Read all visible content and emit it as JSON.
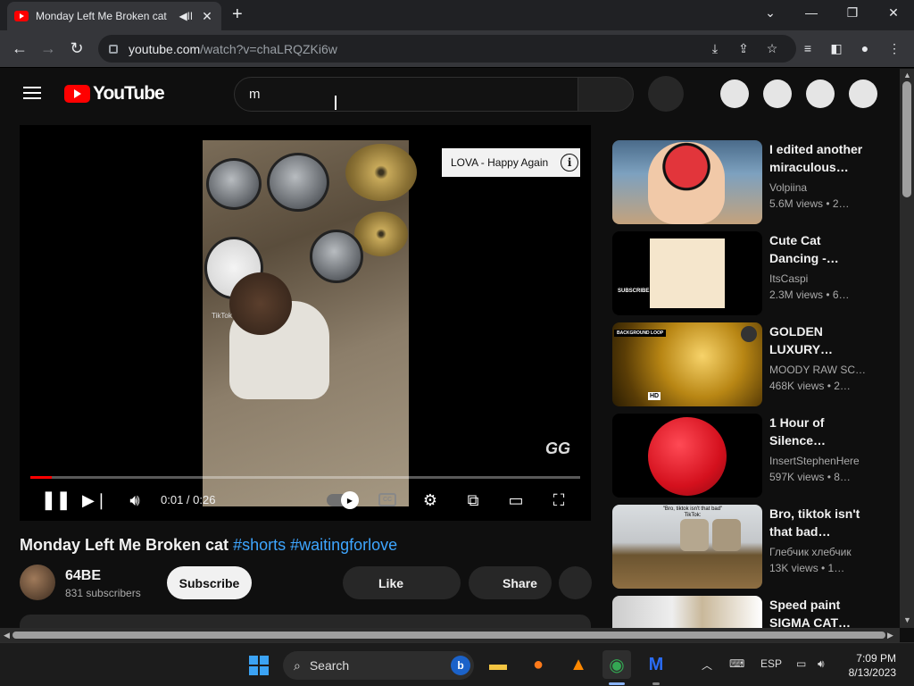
{
  "browser": {
    "tab_title": "Monday Left Me Broken cat",
    "url_host": "youtube.com",
    "url_path": "/watch?v=chaLRQZKi6w"
  },
  "youtube": {
    "logo_text": "YouTube",
    "search_value": "m"
  },
  "player": {
    "song_chip": "LOVA - Happy Again",
    "tiktok_label": "TikTok",
    "brand_mark": "GG",
    "time": "0:01 / 0:26",
    "progress_fraction": 0.0385
  },
  "video": {
    "title": "Monday Left Me Broken cat",
    "hashtags": "#shorts #waitingforlove",
    "channel": "64BE",
    "subscribers": "831 subscribers",
    "subscribe_label": "Subscribe",
    "like_label": "Like",
    "share_label": "Share"
  },
  "recommendations": [
    {
      "title": "I edited another\nmiraculous…",
      "channel": "Volpiina",
      "meta": "5.6M views  • 2…"
    },
    {
      "title": "Cute Cat\nDancing -…",
      "channel": "ItsCaspi",
      "meta": "2.3M views  • 6…"
    },
    {
      "title": "GOLDEN\nLUXURY…",
      "channel": "MOODY RAW SC…",
      "meta": "468K views  • 2…"
    },
    {
      "title": "1 Hour of\nSilence…",
      "channel": "InsertStephenHere",
      "meta": "597K views  • 8…"
    },
    {
      "title": "Bro, tiktok isn't\nthat bad…",
      "channel": "Глебчик хлебчик",
      "meta": "13K views  • 1…"
    },
    {
      "title": "Speed paint\nSIGMA CAT…",
      "channel": "",
      "meta": ""
    }
  ],
  "thumbnail_labels": {
    "subscribe_sticker": "SUBSCRIBE",
    "background_loop": "BACKGROUND LOOP",
    "hd_badge": "HD",
    "bro_caption": "\"Bro, tiktok isn't that bad\"\nTikTok:"
  },
  "taskbar": {
    "search_label": "Search",
    "language": "ESP",
    "time": "7:09 PM",
    "date": "8/13/2023"
  },
  "colors": {
    "accent_red": "#ff0000",
    "link_blue": "#3ea6ff",
    "background": "#0f0f0f"
  }
}
